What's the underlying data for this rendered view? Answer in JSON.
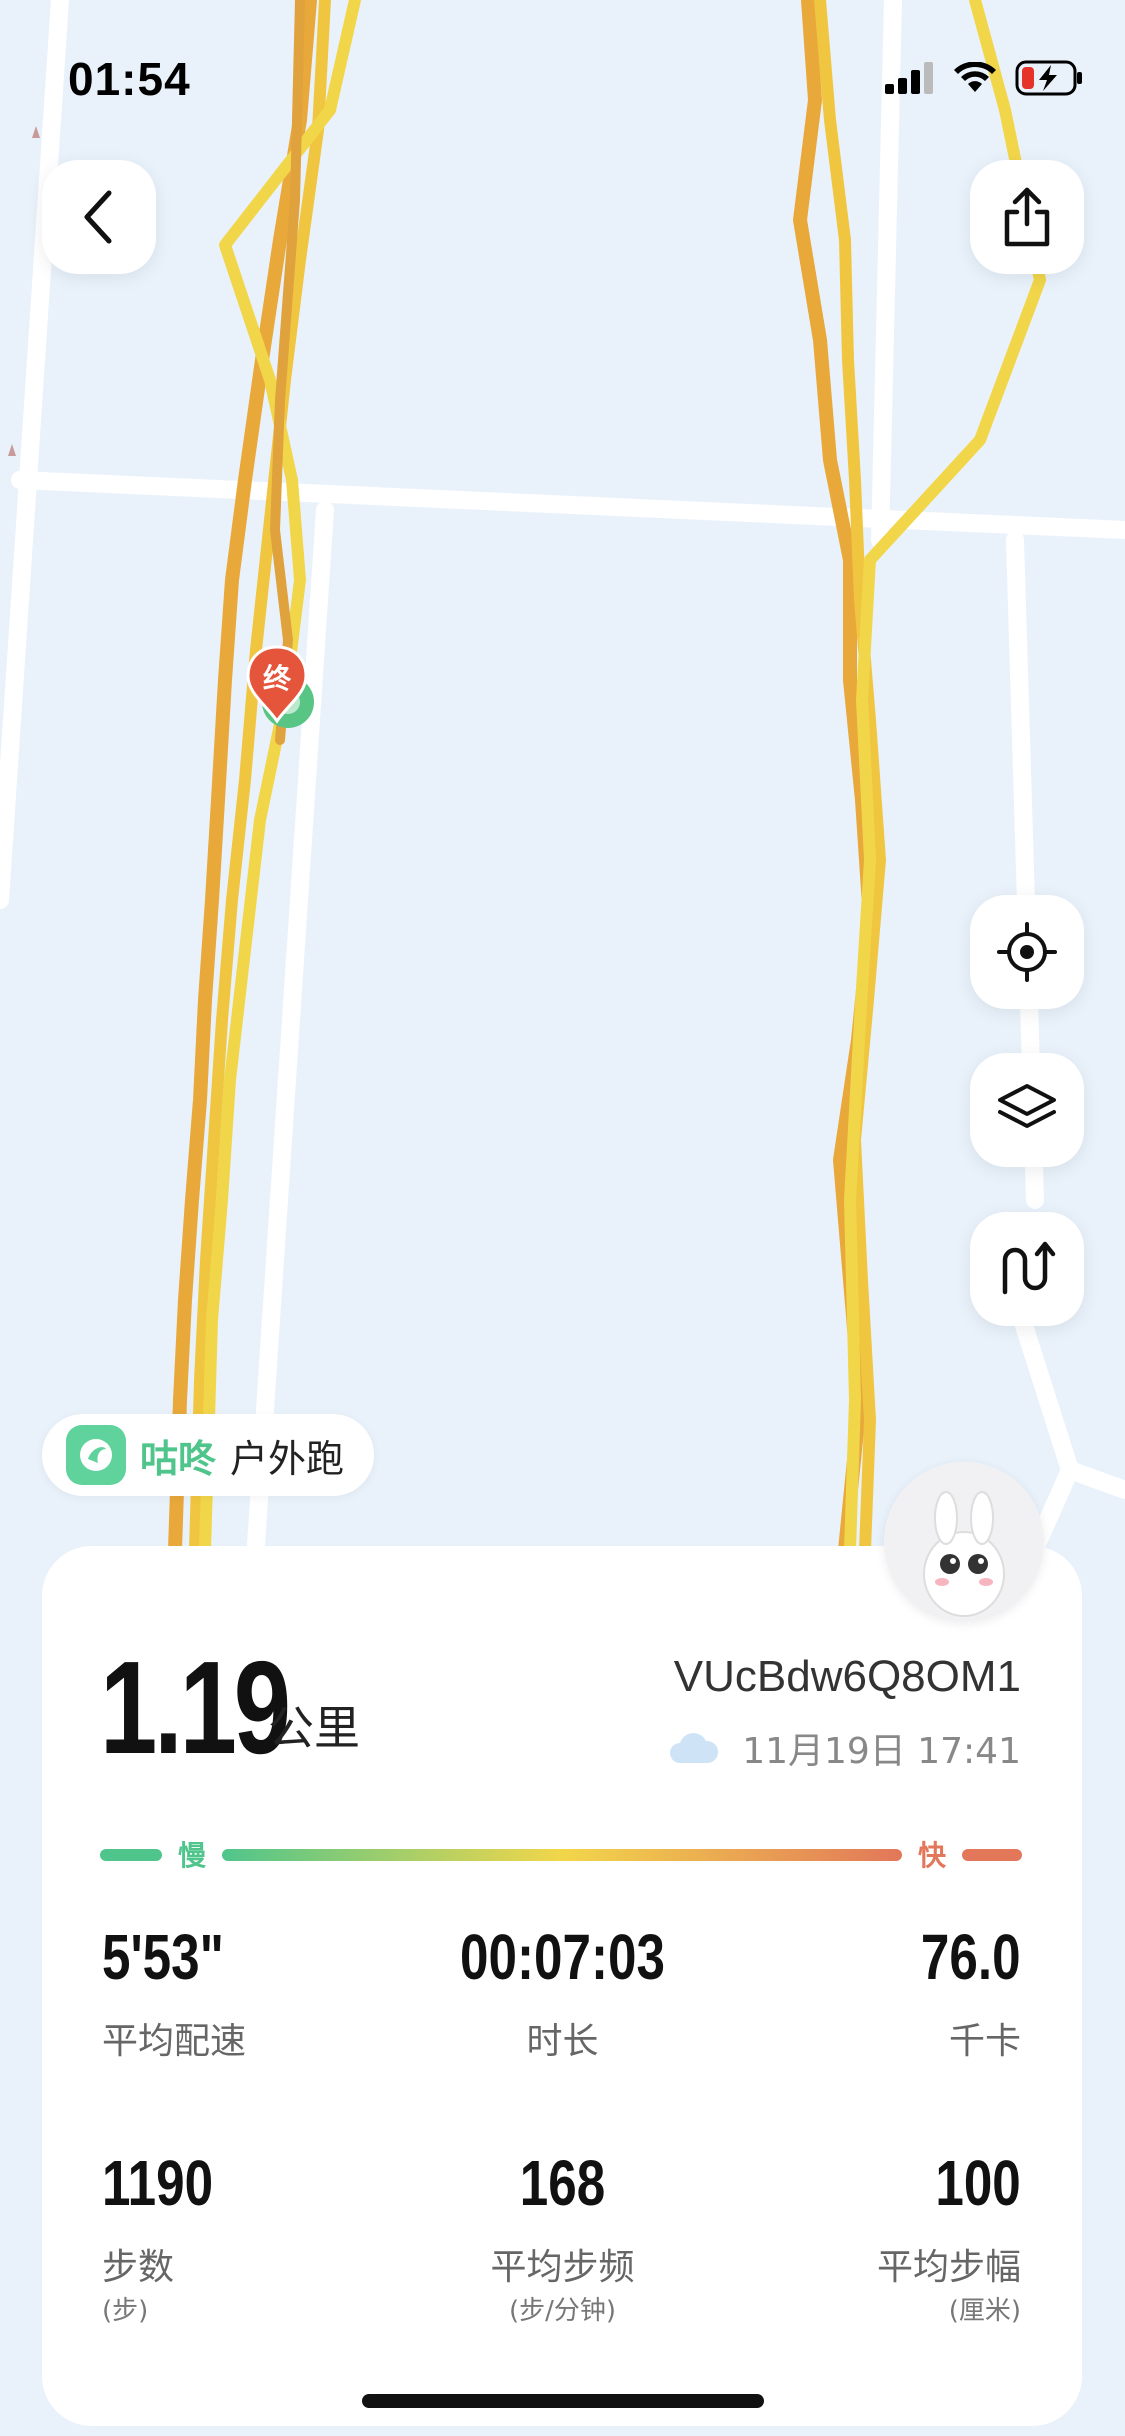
{
  "status_bar": {
    "time": "01:54"
  },
  "map": {
    "end_marker_label": "终",
    "route_colors": {
      "slow": "#e8a83a",
      "fast": "#f2d64a"
    }
  },
  "badge": {
    "brand": "咕咚",
    "activity_type": "户外跑"
  },
  "summary": {
    "distance": "1.19",
    "distance_unit": "公里",
    "run_id": "VUcBdw6Q8OM1",
    "date": "11月19日 17:41",
    "weather_icon": "cloud-icon"
  },
  "pace_legend": {
    "slow_label": "慢",
    "fast_label": "快"
  },
  "stats": [
    {
      "value": "5'53\"",
      "label": "平均配速",
      "sub": ""
    },
    {
      "value": "00:07:03",
      "label": "时长",
      "sub": ""
    },
    {
      "value": "76.0",
      "label": "千卡",
      "sub": ""
    },
    {
      "value": "1190",
      "label": "步数",
      "sub": "(步)"
    },
    {
      "value": "168",
      "label": "平均步频",
      "sub": "(步/分钟)"
    },
    {
      "value": "100",
      "label": "平均步幅",
      "sub": "(厘米)"
    }
  ],
  "colors": {
    "accent_green": "#4fc58c",
    "accent_orange": "#e2775a",
    "map_bg": "#e9f2fb"
  }
}
